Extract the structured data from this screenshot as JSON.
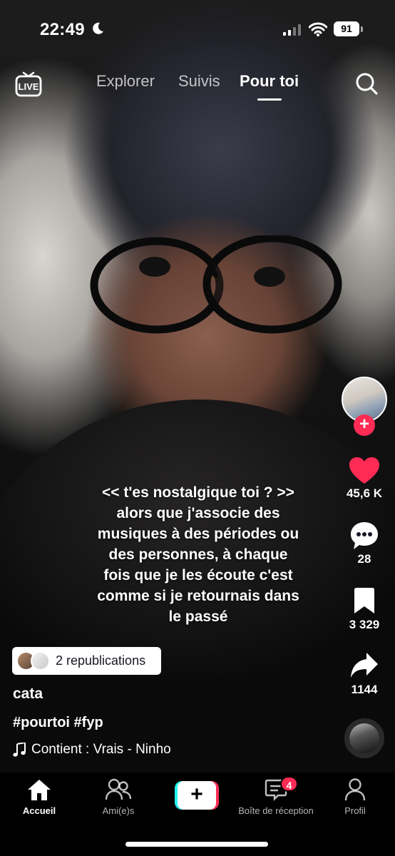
{
  "status_bar": {
    "time": "22:49",
    "battery": "91",
    "icons": [
      "moon-icon",
      "signal-icon",
      "wifi-icon",
      "battery-icon"
    ]
  },
  "top_nav": {
    "live_label": "LIVE",
    "tabs": [
      {
        "label": "Explorer",
        "active": false
      },
      {
        "label": "Suivis",
        "active": false
      },
      {
        "label": "Pour toi",
        "active": true
      }
    ],
    "search_icon": "search-icon"
  },
  "video": {
    "caption_lines": [
      "<< t'es nostalgique toi ? >>",
      "alors que j'associe des",
      "musiques à des périodes ou",
      "des personnes, à chaque",
      "fois que je les écoute c'est",
      "comme si je retournais dans",
      "le passé"
    ],
    "republications": "2 republications",
    "username": "cata",
    "hashtags": "#pourtoi #fyp",
    "sound": "Contient : Vrais - Ninho"
  },
  "actions": {
    "likes": "45,6 K",
    "comments": "28",
    "saves": "3 329",
    "shares": "1144"
  },
  "colors": {
    "accent": "#fe2c55",
    "cyan": "#25f4ee"
  },
  "bottom_nav": {
    "items": [
      {
        "label": "Accueil",
        "icon": "home-icon",
        "active": true
      },
      {
        "label": "Ami(e)s",
        "icon": "friends-icon",
        "active": false
      },
      {
        "label": "",
        "icon": "create-plus-icon",
        "active": false
      },
      {
        "label": "Boîte de réception",
        "icon": "inbox-icon",
        "active": false,
        "badge": "4"
      },
      {
        "label": "Profil",
        "icon": "profile-icon",
        "active": false
      }
    ]
  }
}
